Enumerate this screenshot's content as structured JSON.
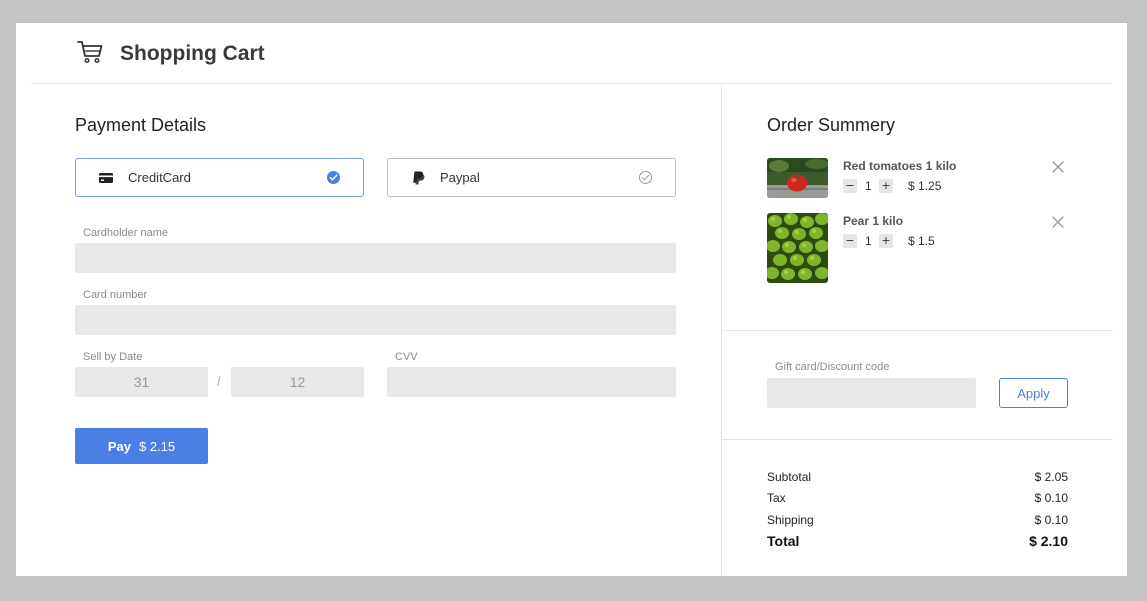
{
  "header": {
    "title": "Shopping Cart",
    "icon": "shopping-cart-icon"
  },
  "payment": {
    "title": "Payment Details",
    "methods": [
      {
        "label": "CreditCard",
        "icon": "credit-card-icon",
        "selected": true
      },
      {
        "label": "Paypal",
        "icon": "paypal-icon",
        "selected": false
      }
    ],
    "cardholder_label": "Cardholder name",
    "cardholder_value": "",
    "card_number_label": "Card number",
    "card_number_value": "",
    "sell_by_label": "Sell by Date",
    "sell_by_day": "31",
    "sell_by_separator": "/",
    "sell_by_month": "12",
    "cvv_label": "CVV",
    "cvv_value": "",
    "pay_label": "Pay",
    "pay_amount": "$ 2.15"
  },
  "summary": {
    "title": "Order Summery",
    "items": [
      {
        "name": "Red tomatoes 1 kilo",
        "qty": "1",
        "price": "$ 1.25",
        "image": "tomato-image"
      },
      {
        "name": "Pear 1 kilo",
        "qty": "1",
        "price": "$ 1.5",
        "image": "pear-image"
      }
    ],
    "qty_minus": "−",
    "qty_plus": "+",
    "discount_label": "Gift card/Discount code",
    "discount_value": "",
    "apply_label": "Apply",
    "subtotal_label": "Subtotal",
    "subtotal_value": "$ 2.05",
    "tax_label": "Tax",
    "tax_value": "$ 0.10",
    "shipping_label": "Shipping",
    "shipping_value": "$ 0.10",
    "total_label": "Total",
    "total_value": "$ 2.10"
  },
  "colors": {
    "accent": "#4a7fe6",
    "field_bg": "#e8e8e8",
    "frame_bg": "#c4c4c4"
  }
}
